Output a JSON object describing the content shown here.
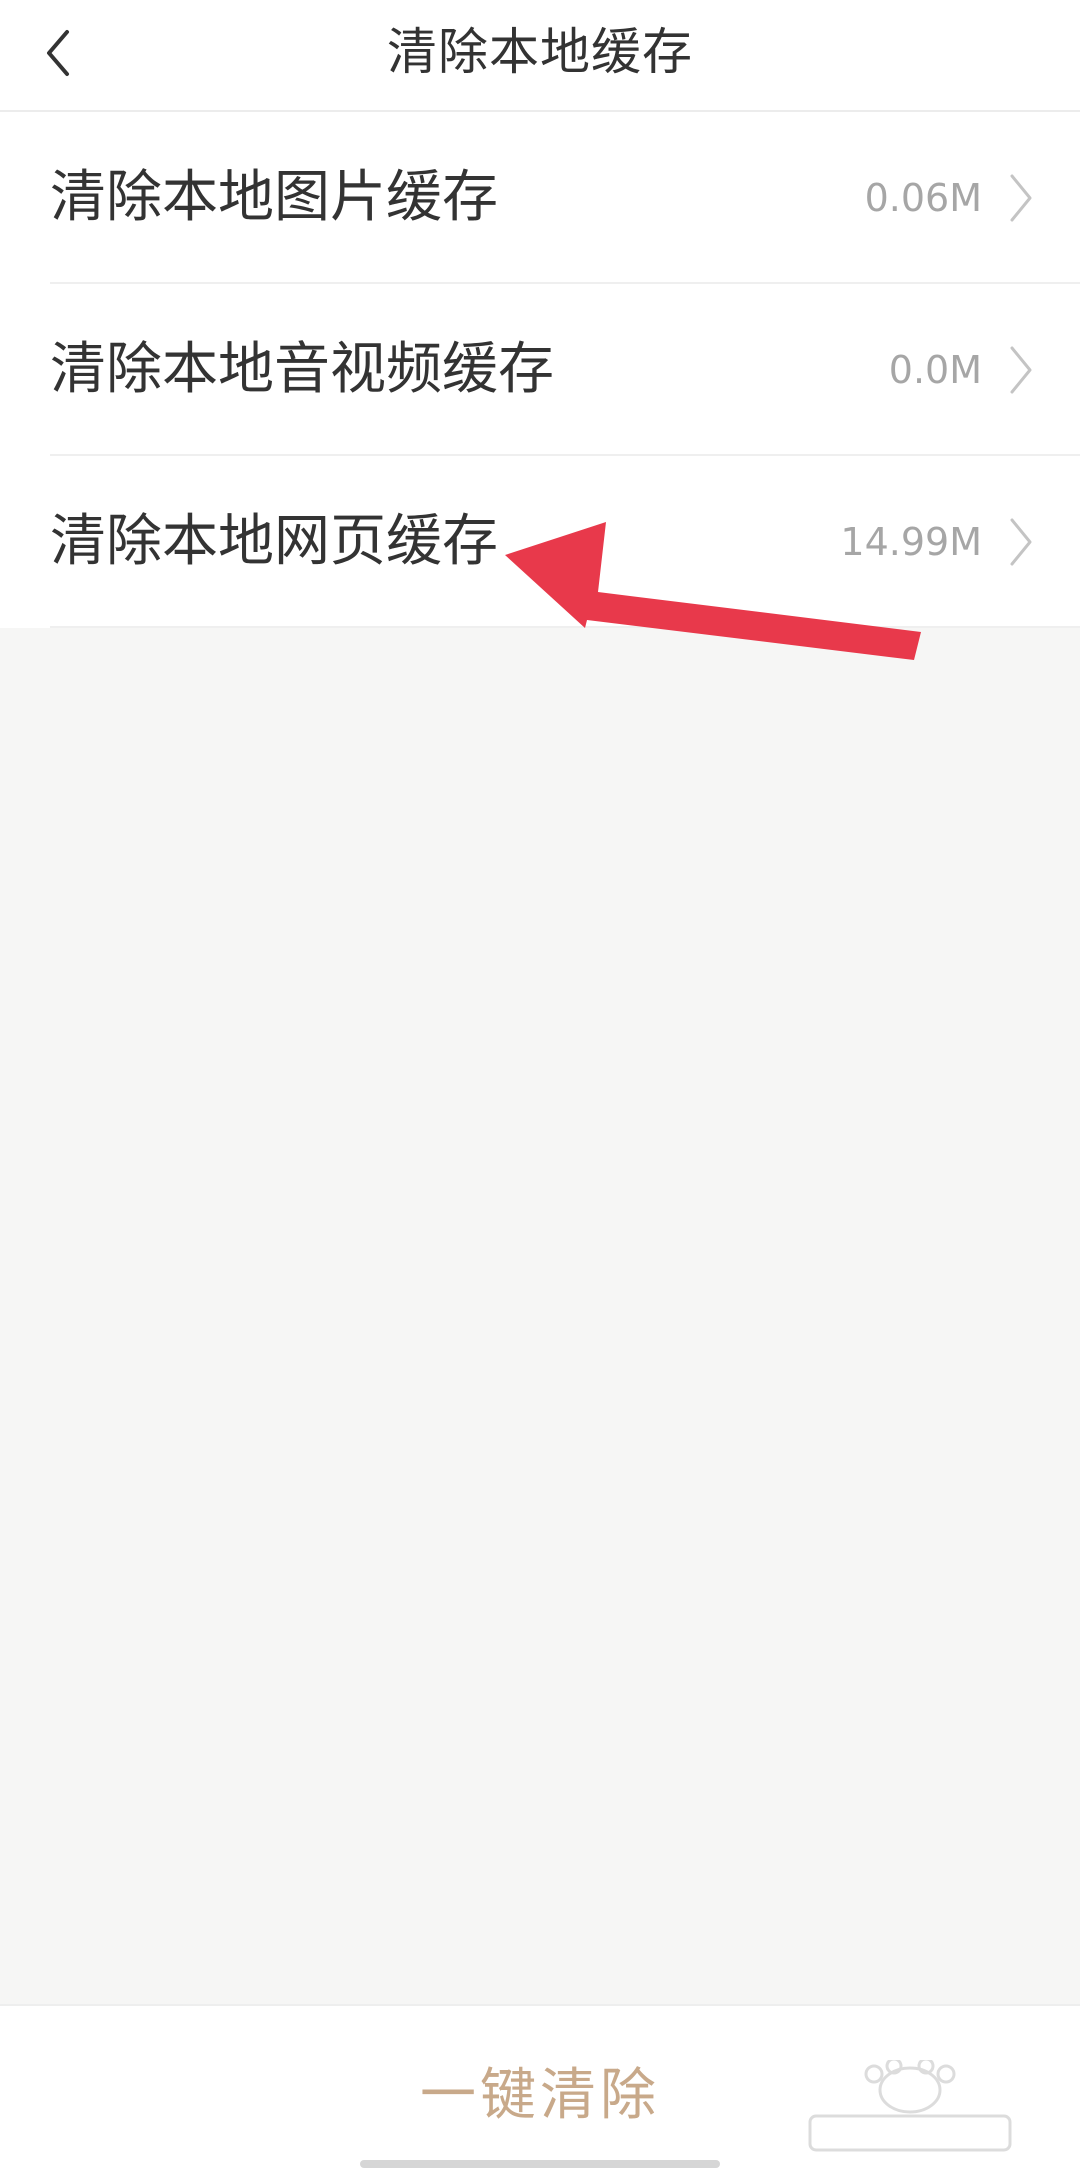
{
  "header": {
    "title": "清除本地缓存",
    "back_icon": "chevron-left-icon"
  },
  "cache_items": [
    {
      "label": "清除本地图片缓存",
      "size": "0.06M"
    },
    {
      "label": "清除本地音视频缓存",
      "size": "0.0M"
    },
    {
      "label": "清除本地网页缓存",
      "size": "14.99M"
    }
  ],
  "footer": {
    "clear_all_label": "一键清除"
  },
  "colors": {
    "accent": "#c8a98a",
    "annotation_arrow": "#e8394b",
    "background": "#f6f6f5"
  }
}
